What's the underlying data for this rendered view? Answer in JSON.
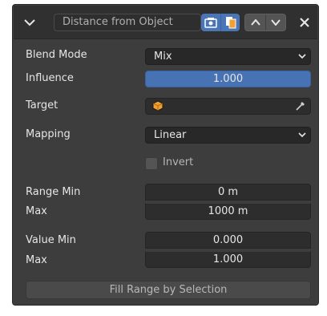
{
  "header": {
    "name": "Distance from Object",
    "icons": {
      "collapse": "chevron-down-icon",
      "camera_toggle": "render-toggle-icon",
      "copy_toggle": "copy-icon",
      "move_up": "chevron-up-icon",
      "move_down": "chevron-down-icon",
      "close": "close-icon"
    }
  },
  "blend_mode": {
    "label": "Blend Mode",
    "value": "Mix"
  },
  "influence": {
    "label": "Influence",
    "value": "1.000"
  },
  "target": {
    "label": "Target",
    "value": "",
    "icon": "object-cube-icon",
    "picker": "eyedropper-icon"
  },
  "mapping": {
    "label": "Mapping",
    "value": "Linear"
  },
  "invert": {
    "label": "Invert",
    "checked": false
  },
  "range": {
    "min_label": "Range Min",
    "min_value": "0 m",
    "max_label": "Max",
    "max_value": "1000 m"
  },
  "value_range": {
    "min_label": "Value Min",
    "min_value": "0.000",
    "max_label": "Max",
    "max_value": "1.000"
  },
  "fill_button": "Fill Range by Selection",
  "colors": {
    "panel_bg": "#3d3d3d",
    "header_bg": "#303030",
    "accent_blue": "#4772b3",
    "field_dark": "#2d2d2d",
    "dropdown_bg": "#282828",
    "object_orange": "#f0a030"
  }
}
